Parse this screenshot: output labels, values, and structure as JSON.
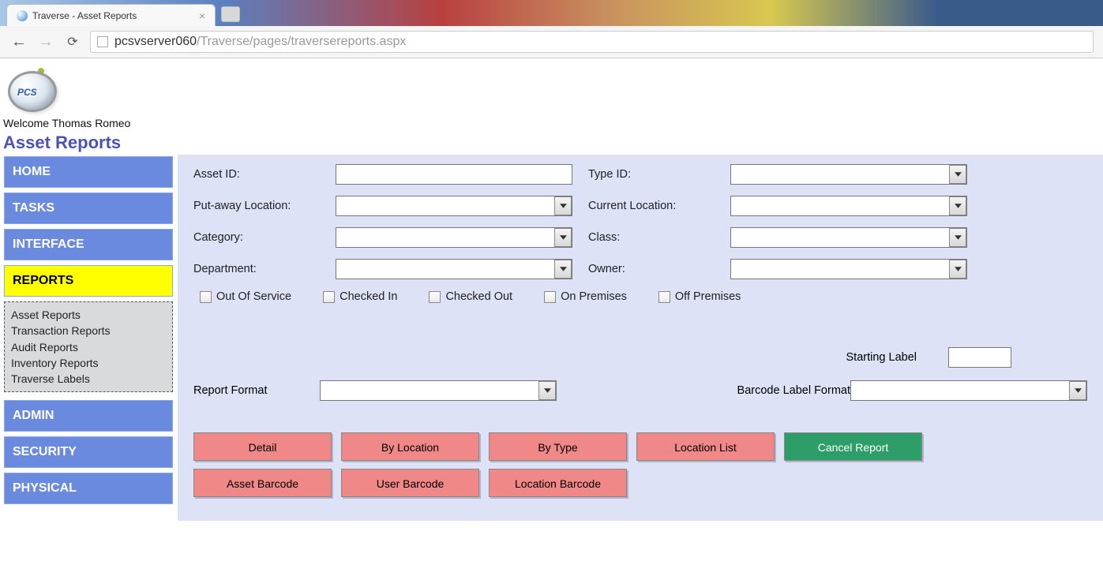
{
  "browser": {
    "tab_title": "Traverse - Asset Reports",
    "url_host": "pcsvserver060",
    "url_path": "/Traverse/pages/traversereports.aspx"
  },
  "header": {
    "logo_text": "PCS",
    "welcome": "Welcome Thomas Romeo",
    "page_title": "Asset Reports"
  },
  "sidebar": {
    "items": [
      {
        "label": "HOME"
      },
      {
        "label": "TASKS"
      },
      {
        "label": "INTERFACE"
      },
      {
        "label": "REPORTS",
        "active": true
      },
      {
        "label": "ADMIN"
      },
      {
        "label": "SECURITY"
      },
      {
        "label": "PHYSICAL"
      }
    ],
    "submenu": [
      "Asset Reports",
      "Transaction Reports",
      "Audit Reports",
      "Inventory Reports",
      "Traverse Labels"
    ]
  },
  "form": {
    "labels": {
      "asset_id": "Asset ID:",
      "type_id": "Type ID:",
      "putaway": "Put-away Location:",
      "current_loc": "Current Location:",
      "category": "Category:",
      "class": "Class:",
      "department": "Department:",
      "owner": "Owner:",
      "report_format": "Report Format",
      "starting_label": "Starting Label",
      "barcode_format": "Barcode Label Format"
    },
    "values": {
      "asset_id": "",
      "type_id": "",
      "putaway": "",
      "current_loc": "",
      "category": "",
      "class": "",
      "department": "",
      "owner": "",
      "report_format": "",
      "starting_label": "",
      "barcode_format": ""
    },
    "checks": {
      "out_of_service": "Out Of Service",
      "checked_in": "Checked In",
      "checked_out": "Checked Out",
      "on_premises": "On Premises",
      "off_premises": "Off Premises"
    }
  },
  "buttons": {
    "detail": "Detail",
    "by_location": "By Location",
    "by_type": "By Type",
    "location_list": "Location List",
    "cancel_report": "Cancel Report",
    "asset_barcode": "Asset Barcode",
    "user_barcode": "User Barcode",
    "location_barcode": "Location Barcode"
  }
}
